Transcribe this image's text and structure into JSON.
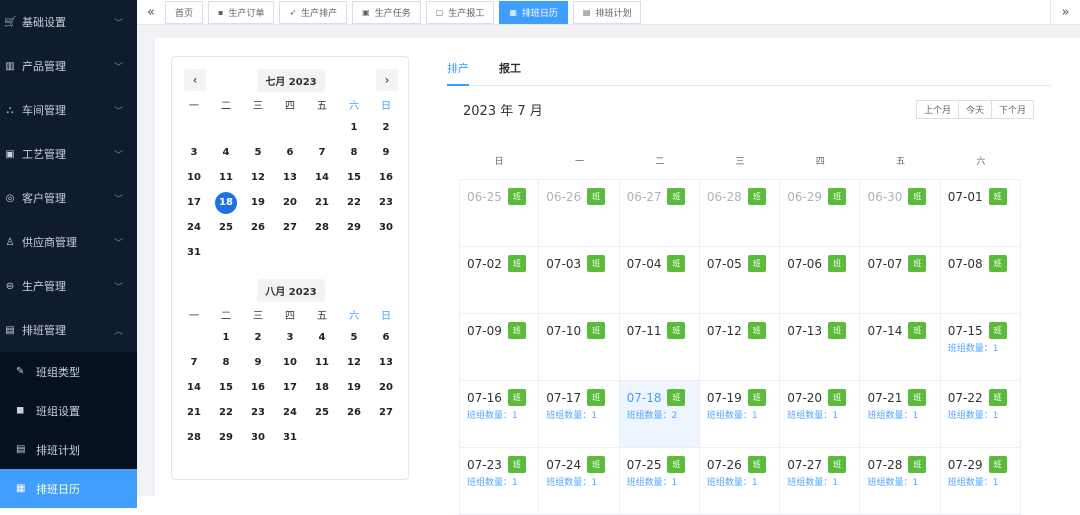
{
  "sidebar": {
    "menus": [
      {
        "icon": "🛒",
        "label": "基础设置"
      },
      {
        "icon": "▥",
        "label": "产品管理"
      },
      {
        "icon": "⛬",
        "label": "车间管理"
      },
      {
        "icon": "▣",
        "label": "工艺管理"
      },
      {
        "icon": "◎",
        "label": "客户管理"
      },
      {
        "icon": "♙",
        "label": "供应商管理"
      },
      {
        "icon": "⊜",
        "label": "生产管理"
      },
      {
        "icon": "▤",
        "label": "排班管理"
      }
    ],
    "submenu": [
      {
        "icon": "✎",
        "label": "班组类型"
      },
      {
        "icon": "◼",
        "label": "班组设置"
      },
      {
        "icon": "▤",
        "label": "排班计划"
      },
      {
        "icon": "▦",
        "label": "排班日历"
      }
    ]
  },
  "tabs": [
    {
      "icon": "",
      "label": "首页"
    },
    {
      "icon": "▪",
      "label": "生产订单"
    },
    {
      "icon": "➶",
      "label": "生产排产"
    },
    {
      "icon": "▣",
      "label": "生产任务"
    },
    {
      "icon": "▢",
      "label": "生产报工"
    },
    {
      "icon": "▦",
      "label": "排班日历"
    },
    {
      "icon": "▤",
      "label": "排班计划"
    }
  ],
  "mini_calendars": [
    {
      "title": "七月 2023"
    },
    {
      "title": "八月 2023"
    }
  ],
  "weekdays_mini": [
    "一",
    "二",
    "三",
    "四",
    "五",
    "六",
    "日"
  ],
  "content_tabs": {
    "schedule": "排产",
    "report": "报工"
  },
  "calendar": {
    "heading": "2023 年 7 月",
    "prev_month": "上个月",
    "today": "今天",
    "next_month": "下个月",
    "weekdays": [
      "日",
      "一",
      "二",
      "三",
      "四",
      "五",
      "六"
    ],
    "shift_label": "班",
    "count_prefix": "班组数量：",
    "cells": [
      {
        "date": "06-25",
        "prev": true
      },
      {
        "date": "06-26",
        "prev": true
      },
      {
        "date": "06-27",
        "prev": true
      },
      {
        "date": "06-28",
        "prev": true
      },
      {
        "date": "06-29",
        "prev": true
      },
      {
        "date": "06-30",
        "prev": true
      },
      {
        "date": "07-01"
      },
      {
        "date": "07-02"
      },
      {
        "date": "07-03"
      },
      {
        "date": "07-04"
      },
      {
        "date": "07-05"
      },
      {
        "date": "07-06"
      },
      {
        "date": "07-07"
      },
      {
        "date": "07-08"
      },
      {
        "date": "07-09"
      },
      {
        "date": "07-10"
      },
      {
        "date": "07-11"
      },
      {
        "date": "07-12"
      },
      {
        "date": "07-13"
      },
      {
        "date": "07-14"
      },
      {
        "date": "07-15",
        "count": "1"
      },
      {
        "date": "07-16",
        "count": "1"
      },
      {
        "date": "07-17",
        "count": "1"
      },
      {
        "date": "07-18",
        "count": "2",
        "selected": true
      },
      {
        "date": "07-19",
        "count": "1"
      },
      {
        "date": "07-20",
        "count": "1"
      },
      {
        "date": "07-21",
        "count": "1"
      },
      {
        "date": "07-22",
        "count": "1"
      },
      {
        "date": "07-23",
        "count": "1"
      },
      {
        "date": "07-24",
        "count": "1"
      },
      {
        "date": "07-25",
        "count": "1"
      },
      {
        "date": "07-26",
        "count": "1"
      },
      {
        "date": "07-27",
        "count": "1"
      },
      {
        "date": "07-28",
        "count": "1"
      },
      {
        "date": "07-29",
        "count": "1"
      }
    ]
  },
  "colors": {
    "accent": "#409eff",
    "shift_badge": "#5bbb3a",
    "sidebar": "#0e1c2e"
  }
}
